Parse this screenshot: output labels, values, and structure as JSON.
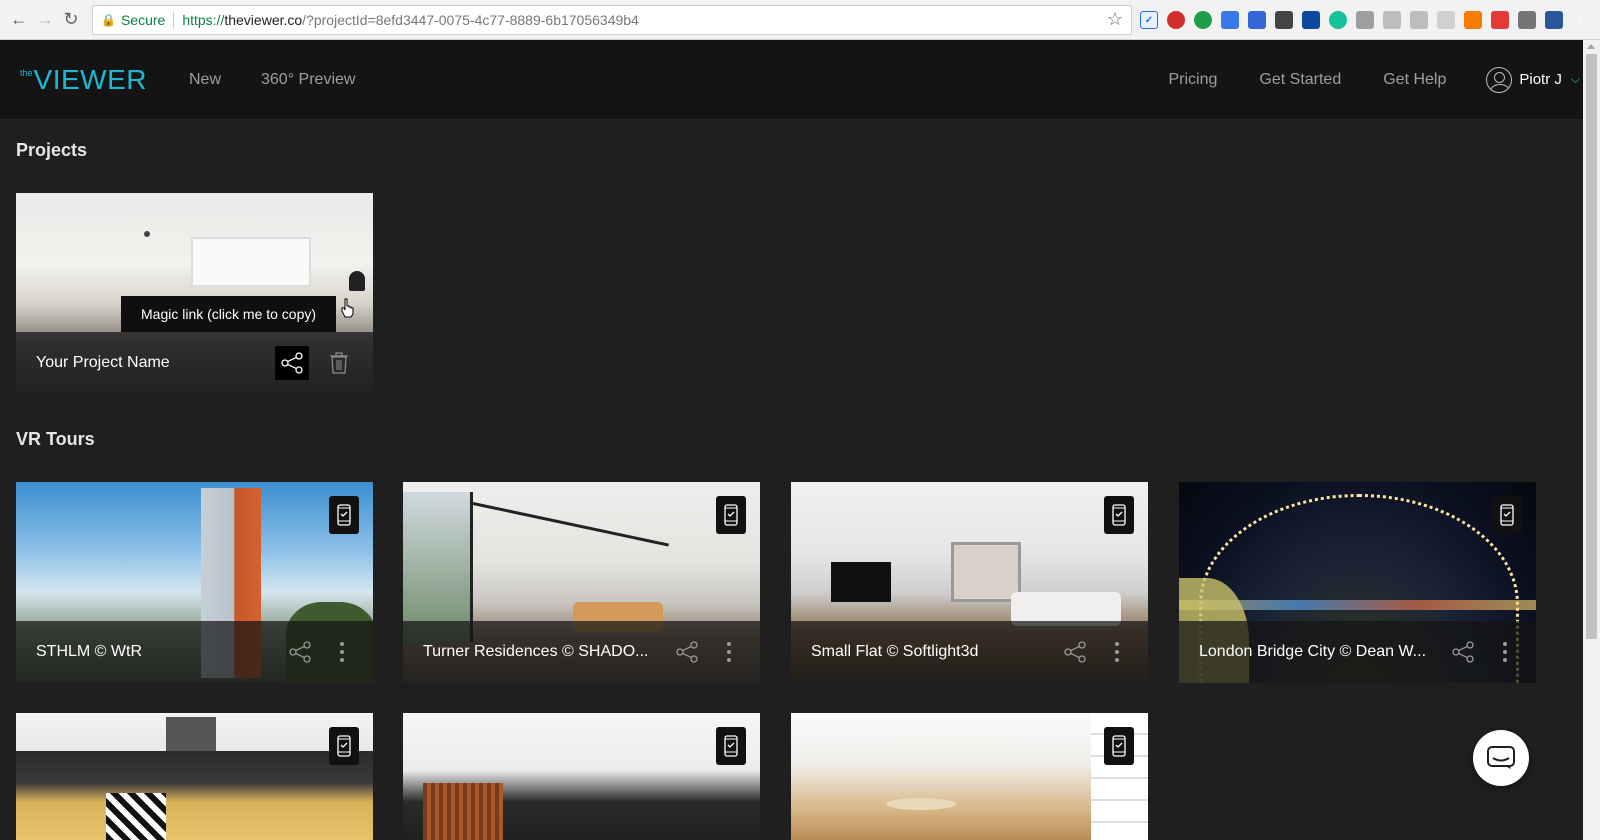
{
  "browser": {
    "secure_label": "Secure",
    "url_scheme": "https://",
    "url_host": "theviewer.co",
    "url_rest": "/?projectId=8efd3447-0075-4c77-8889-6b17056349b4"
  },
  "header": {
    "logo_small": "the",
    "logo_main": "VIEWER",
    "nav": [
      "New",
      "360° Preview"
    ],
    "right_nav": [
      "Pricing",
      "Get Started",
      "Get Help"
    ],
    "user_name": "Piotr J"
  },
  "projects": {
    "title": "Projects",
    "items": [
      {
        "name": "Your Project Name"
      }
    ],
    "tooltip": "Magic link (click me to copy)"
  },
  "vr_tours": {
    "title": "VR Tours",
    "items": [
      {
        "name": "STHLM © WtR"
      },
      {
        "name": "Turner Residences © SHADO..."
      },
      {
        "name": "Small Flat © Softlight3d"
      },
      {
        "name": "London Bridge City © Dean W..."
      },
      {
        "name": ""
      },
      {
        "name": ""
      },
      {
        "name": ""
      }
    ]
  },
  "colors": {
    "accent": "#1fb8d4",
    "page_bg": "#1f1f1f",
    "header_bg": "#141414"
  },
  "icons": [
    "back-icon",
    "forward-icon",
    "reload-icon",
    "lock-icon",
    "star-icon",
    "share-icon",
    "trash-icon",
    "more-icon",
    "vr-phone-icon",
    "user-icon",
    "chevron-down-icon",
    "chat-icon"
  ]
}
